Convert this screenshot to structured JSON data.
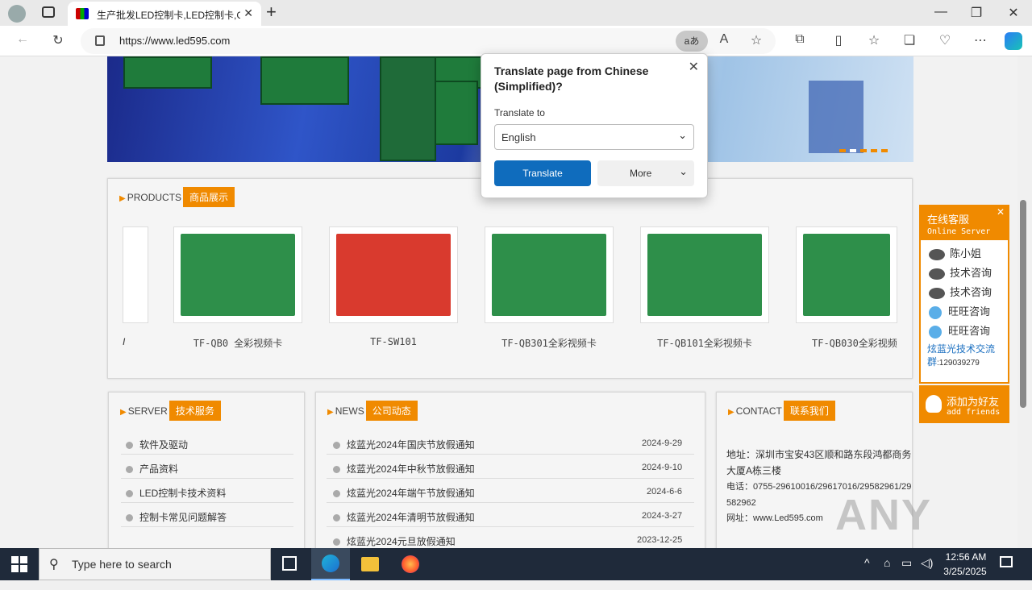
{
  "browser": {
    "tab_title": "生产批发LED控制卡,LED控制卡,G",
    "url": "https://www.led595.com",
    "translate_badge": "aあ",
    "window_min": "—",
    "window_max": "❐",
    "window_close": "✕",
    "tab_close": "✕",
    "new_tab": "+"
  },
  "translate_popup": {
    "title": "Translate page from Chinese (Simplified)?",
    "label": "Translate to",
    "selected": "English",
    "translate_button": "Translate",
    "more_button": "More"
  },
  "products": {
    "en": "PRODUCTS",
    "cn": "商品展示",
    "items": [
      {
        "label": "TF-QB0 全彩视频卡",
        "color": "green"
      },
      {
        "label": "TF-SW101",
        "color": "red"
      },
      {
        "label": "TF-QB301全彩视频卡",
        "color": "green"
      },
      {
        "label": "TF-QB101全彩视频卡",
        "color": "green"
      },
      {
        "label": "TF-QB030全彩视频",
        "color": "green"
      }
    ],
    "partial_label": "I"
  },
  "service": {
    "en": "SERVER",
    "cn": "技术服务",
    "items": [
      "软件及驱动",
      "产品资料",
      "LED控制卡技术资料",
      "控制卡常见问题解答"
    ]
  },
  "news": {
    "en": "NEWS",
    "cn": "公司动态",
    "items": [
      {
        "title": "炫蓝光2024年国庆节放假通知",
        "date": "2024-9-29"
      },
      {
        "title": "炫蓝光2024年中秋节放假通知",
        "date": "2024-9-10"
      },
      {
        "title": "炫蓝光2024年端午节放假通知",
        "date": "2024-6-6"
      },
      {
        "title": "炫蓝光2024年清明节放假通知",
        "date": "2024-3-27"
      },
      {
        "title": "炫蓝光2024元旦放假通知",
        "date": "2023-12-25"
      }
    ]
  },
  "contact": {
    "en": "CONTACT",
    "cn": "联系我们",
    "address": "地址：深圳市宝安43区顺和路东段鸿都商务大厦A栋三楼",
    "phone": "电话：0755-29610016/29617016/29582961/29582962",
    "web": "网址：www.Led595.com"
  },
  "online": {
    "title": "在线客服",
    "subtitle": "Online Server",
    "close": "✕",
    "rows": [
      "陈小姐",
      "技术咨询",
      "技术咨询",
      "旺旺咨询",
      "旺旺咨询"
    ],
    "group_label": "炫蓝光技术交流群",
    "group_num": ":129039279",
    "add_friend": "添加为好友",
    "add_friend_en": "add friends"
  },
  "taskbar": {
    "search_placeholder": "Type here to search",
    "time": "12:56 AM",
    "date": "3/25/2025"
  },
  "watermark": "ANY RUN"
}
